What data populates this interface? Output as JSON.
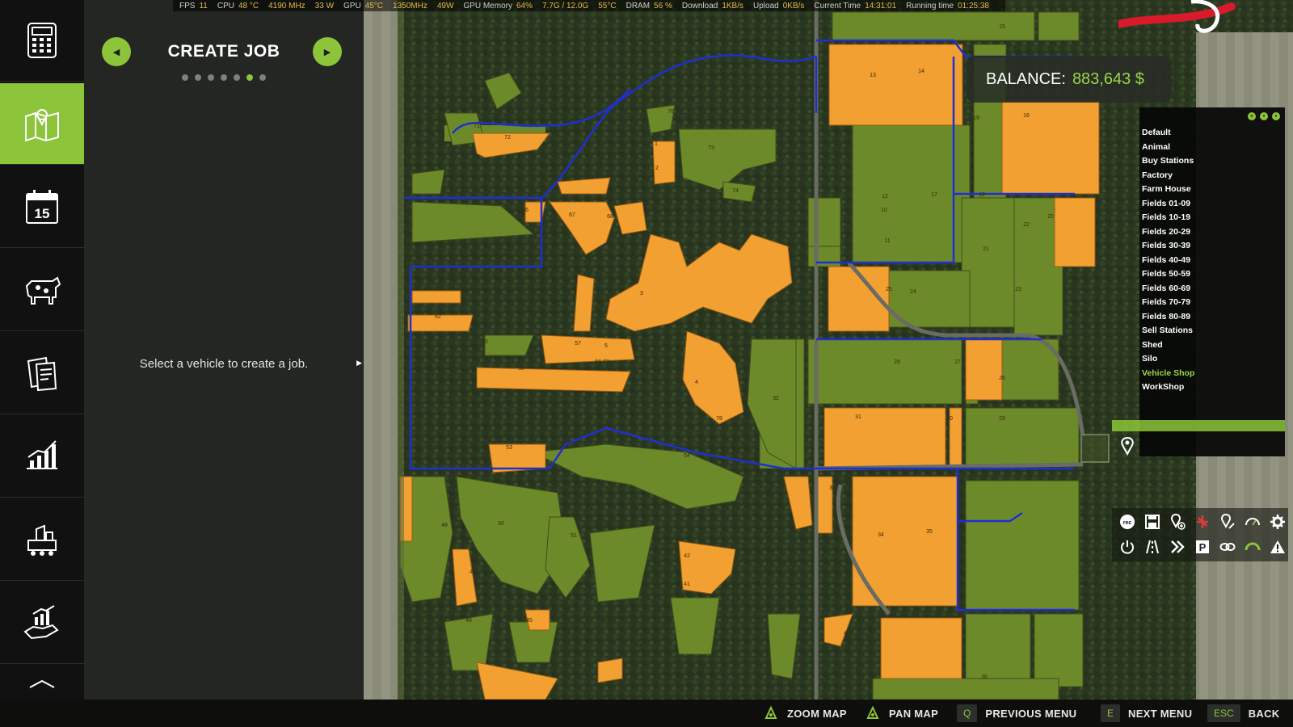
{
  "stats_bar": [
    {
      "label": "FPS",
      "value": "11"
    },
    {
      "label": "CPU",
      "value": "48 °C"
    },
    {
      "label": "",
      "value": "4190 MHz"
    },
    {
      "label": "",
      "value": "33 W"
    },
    {
      "label": "GPU",
      "value": "45°C"
    },
    {
      "label": "",
      "value": "1350MHz"
    },
    {
      "label": "",
      "value": "49W"
    },
    {
      "label": "GPU Memory",
      "value": "64%"
    },
    {
      "label": "",
      "value": "7.7G / 12.0G"
    },
    {
      "label": "",
      "value": "55°C"
    },
    {
      "label": "DRAM",
      "value": "56 %"
    },
    {
      "label": "Download",
      "value": "1KB/s"
    },
    {
      "label": "Upload",
      "value": "0KB/s"
    },
    {
      "label": "Current Time",
      "value": "14:31:01"
    },
    {
      "label": "Running time",
      "value": "01:25:38"
    }
  ],
  "panel": {
    "title": "CREATE JOB",
    "message": "Select a vehicle to create a job.",
    "page_count": 7,
    "active_page": 6,
    "prev_icon": "arrow-left-icon",
    "next_icon": "arrow-right-icon"
  },
  "sidebar": {
    "items": [
      {
        "name": "calculator",
        "icon": "calculator-icon",
        "active": false
      },
      {
        "name": "map",
        "icon": "map-icon",
        "active": true
      },
      {
        "name": "calendar",
        "icon": "calendar-icon",
        "label": "15",
        "active": false
      },
      {
        "name": "animals",
        "icon": "cow-icon",
        "active": false
      },
      {
        "name": "contracts",
        "icon": "documents-icon",
        "active": false
      },
      {
        "name": "statistics",
        "icon": "chart-icon",
        "active": false
      },
      {
        "name": "production",
        "icon": "factory-icon",
        "active": false
      },
      {
        "name": "finances",
        "icon": "hand-chart-icon",
        "active": false
      }
    ]
  },
  "balance": {
    "label": "BALANCE:",
    "value": "883,643 $"
  },
  "hotspots": {
    "items": [
      "Default",
      "Animal",
      "Buy Stations",
      "Factory",
      "Farm House",
      "Fields 01-09",
      "Fields 10-19",
      "Fields 20-29",
      "Fields 30-39",
      "Fields 40-49",
      "Fields 50-59",
      "Fields 60-69",
      "Fields 70-79",
      "Fields 80-89",
      "Sell Stations",
      "Shed",
      "Silo",
      "Vehicle Shop",
      "WorkShop"
    ],
    "highlighted": "Vehicle Shop"
  },
  "toolbar": {
    "row1": [
      "rec-icon",
      "save-icon",
      "add-waypoint-icon",
      "delete-waypoint-icon",
      "edit-waypoint-icon",
      "speedometer-icon",
      "gear-icon"
    ],
    "row2": [
      "power-icon",
      "road-icon",
      "fast-forward-icon",
      "parking-icon",
      "link-icon",
      "gauge-icon",
      "warning-icon"
    ],
    "parking_label": "P",
    "rec_label": "rec"
  },
  "map_labels": [
    "72",
    "71",
    "70",
    "68",
    "67",
    "66",
    "65",
    "64",
    "63",
    "62",
    "61",
    "60",
    "59",
    "58",
    "57",
    "56",
    "55",
    "54",
    "53",
    "52",
    "51",
    "50",
    "49",
    "48",
    "47",
    "46",
    "45",
    "44",
    "43",
    "42",
    "41",
    "40",
    "39",
    "38",
    "37",
    "36",
    "35",
    "34",
    "33",
    "32",
    "31",
    "30",
    "29",
    "28",
    "27",
    "26",
    "25",
    "24",
    "23",
    "22",
    "21",
    "20",
    "19",
    "18",
    "17",
    "16",
    "15",
    "14",
    "13",
    "12",
    "11",
    "10",
    "9",
    "8",
    "7",
    "6",
    "5",
    "4",
    "3",
    "2",
    "1",
    "73",
    "74",
    "75",
    "76",
    "77",
    "78"
  ],
  "bottom_bar": [
    {
      "key": "",
      "icon": "controller-icon",
      "label": "ZOOM MAP"
    },
    {
      "key": "",
      "icon": "controller-icon",
      "label": "PAN MAP"
    },
    {
      "key": "Q",
      "label": "PREVIOUS MENU"
    },
    {
      "key": "E",
      "label": "NEXT MENU"
    },
    {
      "key": "ESC",
      "label": "BACK"
    }
  ],
  "colors": {
    "accent": "#8cc43a",
    "field_orange": "#f3a033",
    "field_olive": "#6d8a2a",
    "route_blue": "#1f2fd0"
  }
}
